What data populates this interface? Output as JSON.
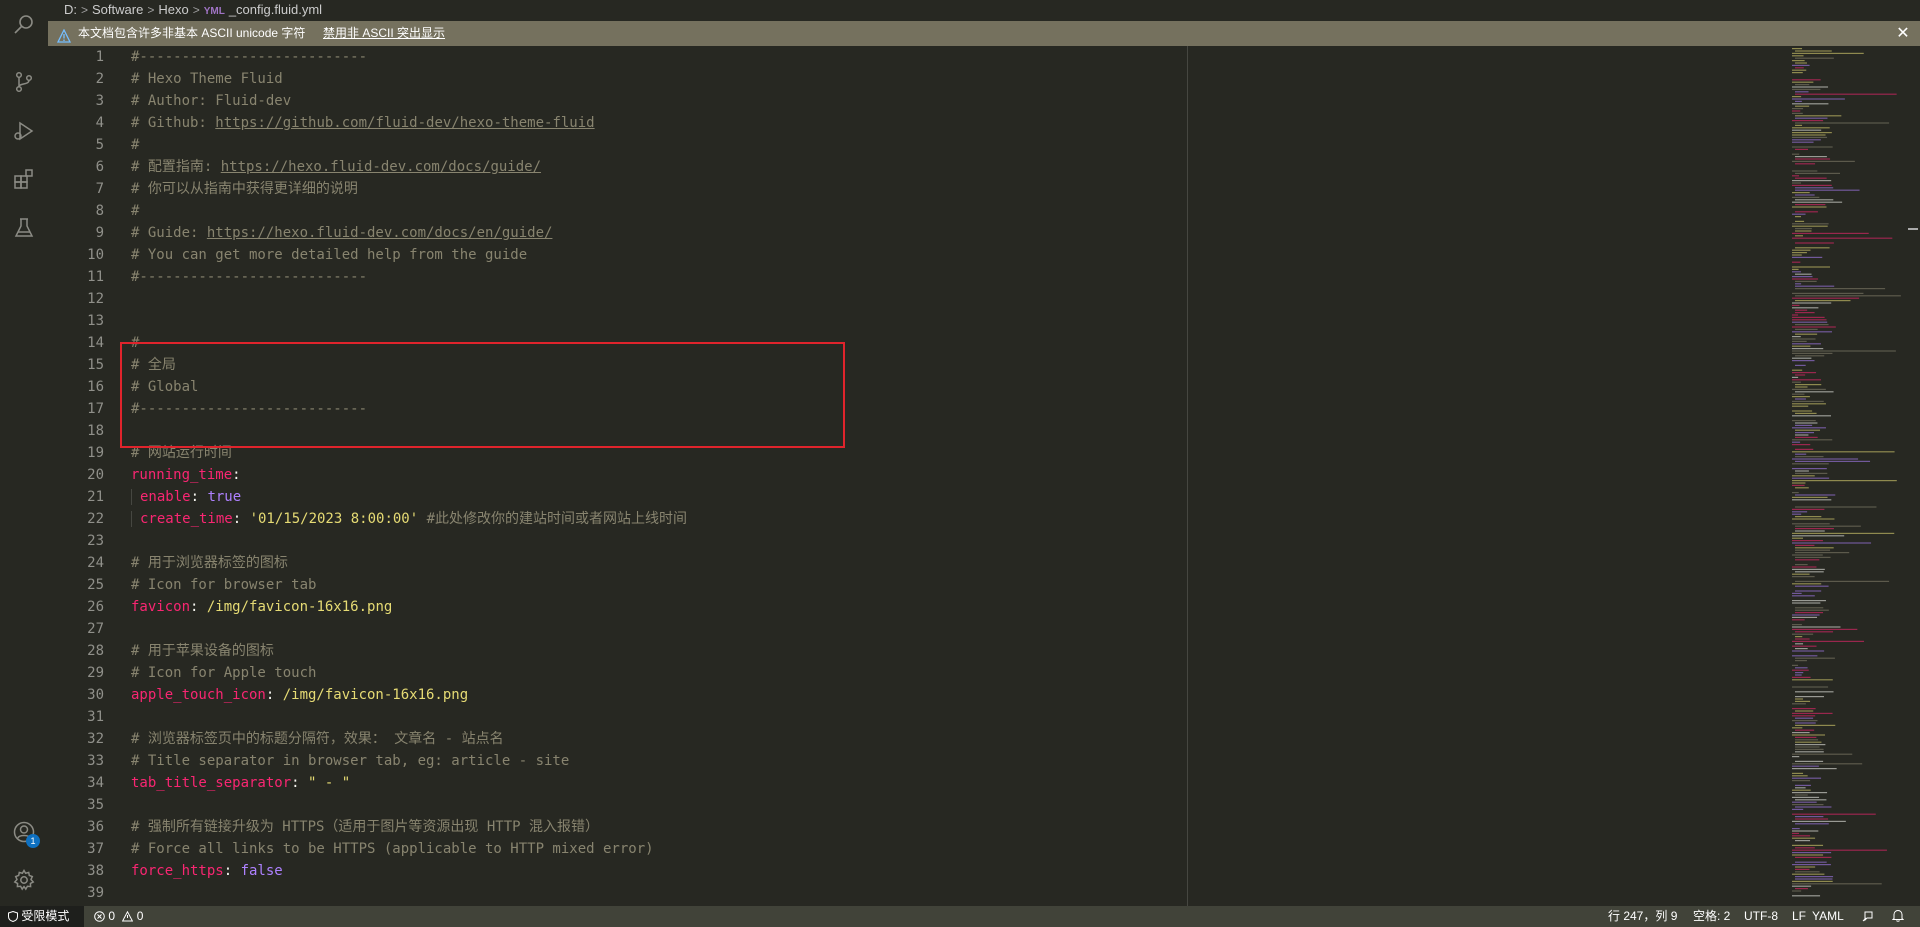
{
  "breadcrumb": {
    "drive": "D:",
    "folder1": "Software",
    "folder2": "Hexo",
    "file_icon": "YML",
    "file": "_config.fluid.yml"
  },
  "banner": {
    "message": "本文档包含许多非基本 ASCII unicode 字符",
    "disable_link": "禁用非 ASCII 突出显示",
    "close_glyph": "✕"
  },
  "activity": {
    "accounts_badge": "1"
  },
  "editor": {
    "lines": [
      {
        "n": "1",
        "t": [
          {
            "c": "c",
            "v": "#---------------------------"
          }
        ]
      },
      {
        "n": "2",
        "t": [
          {
            "c": "c",
            "v": "# Hexo Theme Fluid"
          }
        ]
      },
      {
        "n": "3",
        "t": [
          {
            "c": "c",
            "v": "# Author: Fluid-dev"
          }
        ]
      },
      {
        "n": "4",
        "t": [
          {
            "c": "c",
            "v": "# Github: "
          },
          {
            "c": "c u",
            "v": "https://github.com/fluid-dev/hexo-theme-fluid"
          }
        ]
      },
      {
        "n": "5",
        "t": [
          {
            "c": "c",
            "v": "#"
          }
        ]
      },
      {
        "n": "6",
        "t": [
          {
            "c": "c",
            "v": "# 配置指南: "
          },
          {
            "c": "c u",
            "v": "https://hexo.fluid-dev.com/docs/guide/"
          }
        ]
      },
      {
        "n": "7",
        "t": [
          {
            "c": "c",
            "v": "# 你可以从指南中获得更详细的说明"
          }
        ]
      },
      {
        "n": "8",
        "t": [
          {
            "c": "c",
            "v": "#"
          }
        ]
      },
      {
        "n": "9",
        "t": [
          {
            "c": "c",
            "v": "# Guide: "
          },
          {
            "c": "c u",
            "v": "https://hexo.fluid-dev.com/docs/en/guide/"
          }
        ]
      },
      {
        "n": "10",
        "t": [
          {
            "c": "c",
            "v": "# You can get more detailed help from the guide"
          }
        ]
      },
      {
        "n": "11",
        "t": [
          {
            "c": "c",
            "v": "#---------------------------"
          }
        ]
      },
      {
        "n": "12",
        "t": []
      },
      {
        "n": "13",
        "t": []
      },
      {
        "n": "14",
        "t": [
          {
            "c": "c",
            "v": "#---------------------------"
          }
        ]
      },
      {
        "n": "15",
        "t": [
          {
            "c": "c",
            "v": "# 全局"
          }
        ]
      },
      {
        "n": "16",
        "t": [
          {
            "c": "c",
            "v": "# Global"
          }
        ]
      },
      {
        "n": "17",
        "t": [
          {
            "c": "c",
            "v": "#---------------------------"
          }
        ]
      },
      {
        "n": "18",
        "t": []
      },
      {
        "n": "19",
        "t": [
          {
            "c": "c",
            "v": "# 网站运行时间"
          }
        ]
      },
      {
        "n": "20",
        "t": [
          {
            "c": "k",
            "v": "running_time"
          },
          {
            "c": "",
            "v": ":"
          }
        ]
      },
      {
        "n": "21",
        "indent": true,
        "t": [
          {
            "c": "k",
            "v": "enable"
          },
          {
            "c": "",
            "v": ": "
          },
          {
            "c": "b",
            "v": "true"
          }
        ]
      },
      {
        "n": "22",
        "indent": true,
        "t": [
          {
            "c": "k",
            "v": "create_time"
          },
          {
            "c": "",
            "v": ": "
          },
          {
            "c": "s",
            "v": "'01/15/2023 8:00:00'"
          },
          {
            "c": "c",
            "v": " #此处修改你的建站时间或者网站上线时间"
          }
        ]
      },
      {
        "n": "23",
        "t": []
      },
      {
        "n": "24",
        "t": [
          {
            "c": "c",
            "v": "# 用于浏览器标签的图标"
          }
        ]
      },
      {
        "n": "25",
        "t": [
          {
            "c": "c",
            "v": "# Icon for browser tab"
          }
        ]
      },
      {
        "n": "26",
        "t": [
          {
            "c": "k",
            "v": "favicon"
          },
          {
            "c": "",
            "v": ": "
          },
          {
            "c": "s",
            "v": "/img/favicon-16x16.png"
          }
        ]
      },
      {
        "n": "27",
        "t": []
      },
      {
        "n": "28",
        "t": [
          {
            "c": "c",
            "v": "# 用于苹果设备的图标"
          }
        ]
      },
      {
        "n": "29",
        "t": [
          {
            "c": "c",
            "v": "# Icon for Apple touch"
          }
        ]
      },
      {
        "n": "30",
        "t": [
          {
            "c": "k",
            "v": "apple_touch_icon"
          },
          {
            "c": "",
            "v": ": "
          },
          {
            "c": "s",
            "v": "/img/favicon-16x16.png"
          }
        ]
      },
      {
        "n": "31",
        "t": []
      },
      {
        "n": "32",
        "t": [
          {
            "c": "c",
            "v": "# 浏览器标签页中的标题分隔符，效果： 文章名 - 站点名"
          }
        ]
      },
      {
        "n": "33",
        "t": [
          {
            "c": "c",
            "v": "# Title separator in browser tab, eg: article - site"
          }
        ]
      },
      {
        "n": "34",
        "t": [
          {
            "c": "k",
            "v": "tab_title_separator"
          },
          {
            "c": "",
            "v": ": "
          },
          {
            "c": "s",
            "v": "\" - \""
          }
        ]
      },
      {
        "n": "35",
        "t": []
      },
      {
        "n": "36",
        "t": [
          {
            "c": "c",
            "v": "# 强制所有链接升级为 HTTPS（适用于图片等资源出现 HTTP 混入报错）"
          }
        ]
      },
      {
        "n": "37",
        "t": [
          {
            "c": "c",
            "v": "# Force all links to be HTTPS (applicable to HTTP mixed error)"
          }
        ]
      },
      {
        "n": "38",
        "t": [
          {
            "c": "k",
            "v": "force_https"
          },
          {
            "c": "",
            "v": ": "
          },
          {
            "c": "b",
            "v": "false"
          }
        ]
      },
      {
        "n": "39",
        "t": []
      }
    ]
  },
  "status": {
    "restricted_mode": "受限模式",
    "errors": "0",
    "warnings": "0",
    "cursor": "行 247，列 9",
    "indent": "空格: 2",
    "encoding": "UTF-8",
    "eol": "LF",
    "language": "YAML"
  }
}
